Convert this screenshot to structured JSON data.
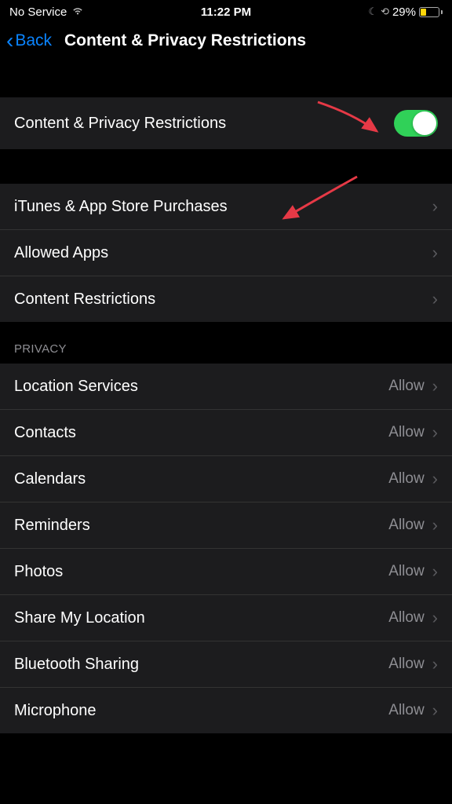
{
  "status": {
    "carrier": "No Service",
    "time": "11:22 PM",
    "battery_pct": "29%"
  },
  "nav": {
    "back_label": "Back",
    "title": "Content & Privacy Restrictions"
  },
  "main_toggle": {
    "label": "Content & Privacy Restrictions",
    "on": true
  },
  "purchase_rows": {
    "itunes": "iTunes & App Store Purchases",
    "allowed": "Allowed Apps",
    "content": "Content Restrictions"
  },
  "privacy_header": "Privacy",
  "privacy_rows": [
    {
      "label": "Location Services",
      "value": "Allow"
    },
    {
      "label": "Contacts",
      "value": "Allow"
    },
    {
      "label": "Calendars",
      "value": "Allow"
    },
    {
      "label": "Reminders",
      "value": "Allow"
    },
    {
      "label": "Photos",
      "value": "Allow"
    },
    {
      "label": "Share My Location",
      "value": "Allow"
    },
    {
      "label": "Bluetooth Sharing",
      "value": "Allow"
    },
    {
      "label": "Microphone",
      "value": "Allow"
    }
  ]
}
